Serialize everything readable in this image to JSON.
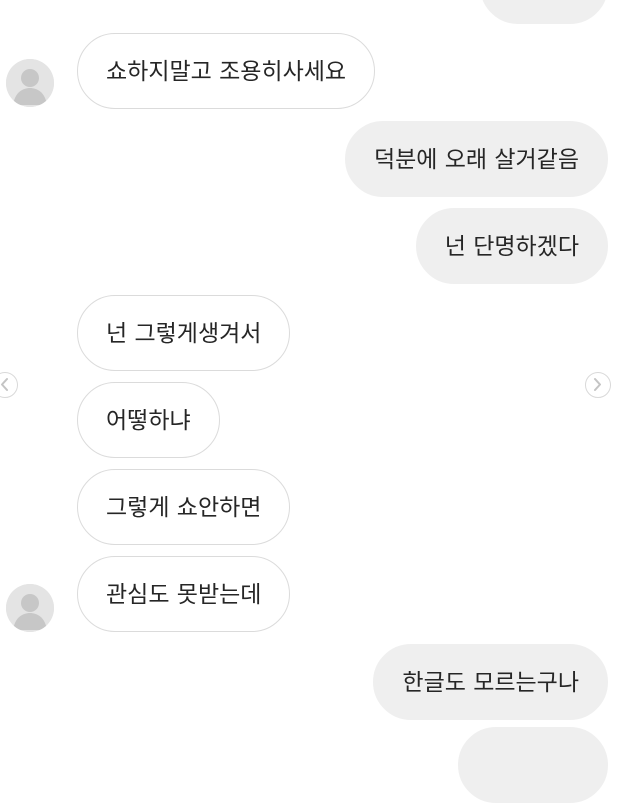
{
  "messages": [
    {
      "side": "sent",
      "text": ""
    },
    {
      "side": "received",
      "text": "쇼하지말고 조용히사세요"
    },
    {
      "side": "sent",
      "text": "덕분에 오래 살거같음"
    },
    {
      "side": "sent",
      "text": "넌 단명하겠다"
    },
    {
      "side": "received",
      "text": "넌 그렇게생겨서"
    },
    {
      "side": "received",
      "text": "어떻하냐"
    },
    {
      "side": "received",
      "text": "그렇게 쇼안하면"
    },
    {
      "side": "received",
      "text": "관심도 못받는데"
    },
    {
      "side": "sent",
      "text": "한글도 모르는구나"
    },
    {
      "side": "sent",
      "text": ""
    }
  ],
  "icons": {
    "avatar": "default-avatar-icon",
    "prev": "chevron-left-icon",
    "next": "chevron-right-icon"
  }
}
